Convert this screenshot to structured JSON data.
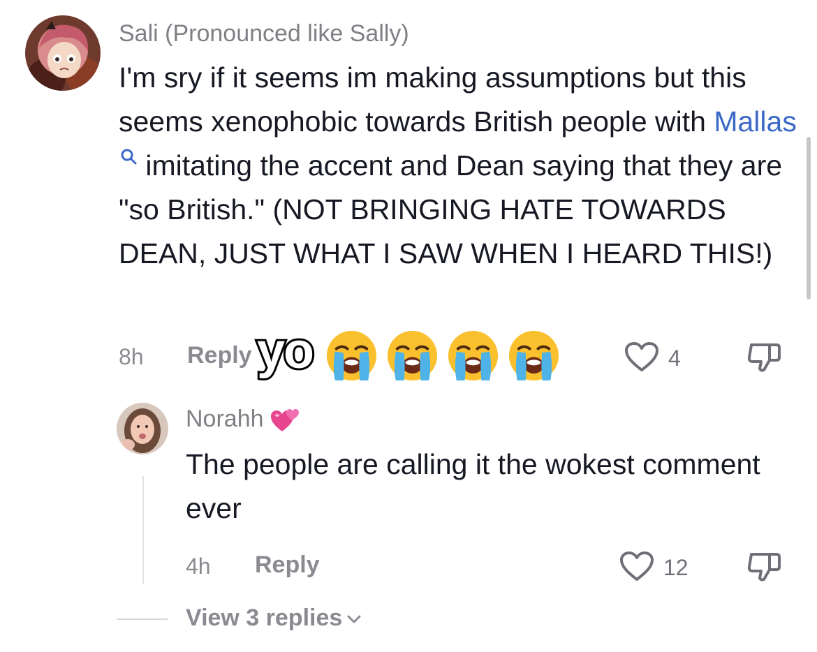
{
  "comment": {
    "username": "Sali (Pronounced like Sally)",
    "text_part1": "I'm sry if it seems im making assumptions but this seems xenophobic towards British people with ",
    "mention": "Mallas",
    "text_part2": " imitating the accent and Dean saying that they are \"so British.\" (NOT BRINGING HATE TOWARDS DEAN, JUST WHAT I SAW WHEN I HEARD THIS!)",
    "time": "8h",
    "reply_label": "Reply",
    "likes": "4",
    "sticker_text": "yo",
    "sticker_emojis": [
      "loudly-crying-face",
      "loudly-crying-face",
      "loudly-crying-face",
      "loudly-crying-face"
    ]
  },
  "reply": {
    "username": "Norahh",
    "username_emoji": "two-hearts-emoji",
    "text": "The people are calling it the wokest comment ever",
    "time": "4h",
    "reply_label": "Reply",
    "likes": "12"
  },
  "view_replies": {
    "label": "View 3 replies"
  },
  "colors": {
    "mention": "#3b69c7",
    "meta_gray": "#8a8b91",
    "text": "#161823"
  }
}
